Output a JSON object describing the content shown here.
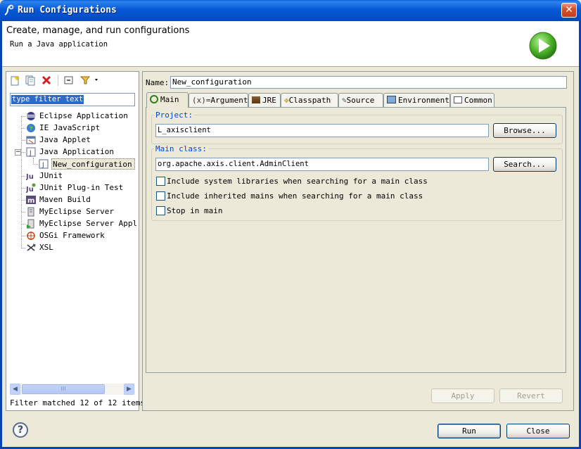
{
  "window": {
    "title": "Run Configurations",
    "close_glyph": "✕"
  },
  "banner": {
    "title": "Create, manage, and run configurations",
    "subtitle": "Run a Java application"
  },
  "left": {
    "toolbar_icons": [
      "new-launch-config-icon",
      "duplicate-icon",
      "delete-icon",
      "collapse-all-icon",
      "filter-icon"
    ],
    "filter_text": "type filter text",
    "tree": [
      {
        "label": "Eclipse Application",
        "icon": "eclipse-icon"
      },
      {
        "label": "IE JavaScript",
        "icon": "globe-icon"
      },
      {
        "label": "Java Applet",
        "icon": "applet-icon"
      },
      {
        "label": "Java Application",
        "icon": "java-app-icon",
        "expanded": true
      },
      {
        "label": "New_configuration",
        "icon": "java-app-icon",
        "child": true,
        "selected": true
      },
      {
        "label": "JUnit",
        "icon": "junit-icon"
      },
      {
        "label": "JUnit Plug-in Test",
        "icon": "junit-plugin-icon"
      },
      {
        "label": "Maven Build",
        "icon": "maven-icon"
      },
      {
        "label": "MyEclipse Server",
        "icon": "server-icon"
      },
      {
        "label": "MyEclipse Server Applic",
        "icon": "server-app-icon"
      },
      {
        "label": "OSGi Framework",
        "icon": "osgi-icon"
      },
      {
        "label": "XSL",
        "icon": "xsl-icon"
      }
    ],
    "scroll_grip": "III",
    "status": "Filter matched 12 of 12 items"
  },
  "right": {
    "name_label": "Name:",
    "name_value": "New_configuration",
    "tabs": [
      {
        "label": "Main",
        "icon": "main-tab-icon"
      },
      {
        "label": "Arguments",
        "icon": "arguments-icon"
      },
      {
        "label": "JRE",
        "icon": "jre-icon"
      },
      {
        "label": "Classpath",
        "icon": "classpath-icon"
      },
      {
        "label": "Source",
        "icon": "source-icon"
      },
      {
        "label": "Environment",
        "icon": "environment-icon"
      },
      {
        "label": "Common",
        "icon": "common-icon"
      }
    ],
    "project_label": "Project:",
    "project_value": "L_axisclient",
    "browse_label": "Browse...",
    "main_class_label": "Main class:",
    "main_class_value": "org.apache.axis.client.AdminClient",
    "search_label": "Search...",
    "checkboxes": [
      {
        "label": "Include system libraries when searching for a main class",
        "checked": false
      },
      {
        "label": "Include inherited mains when searching for a main class",
        "checked": false
      },
      {
        "label": "Stop in main",
        "checked": false
      }
    ],
    "apply_label": "Apply",
    "revert_label": "Revert"
  },
  "footer": {
    "help_glyph": "?",
    "run_label": "Run",
    "close_label": "Close"
  },
  "colors": {
    "titlebar": "#0658d6",
    "dialog_bg": "#ece9d8",
    "selection": "#316ac5",
    "group_label": "#0046d5"
  }
}
